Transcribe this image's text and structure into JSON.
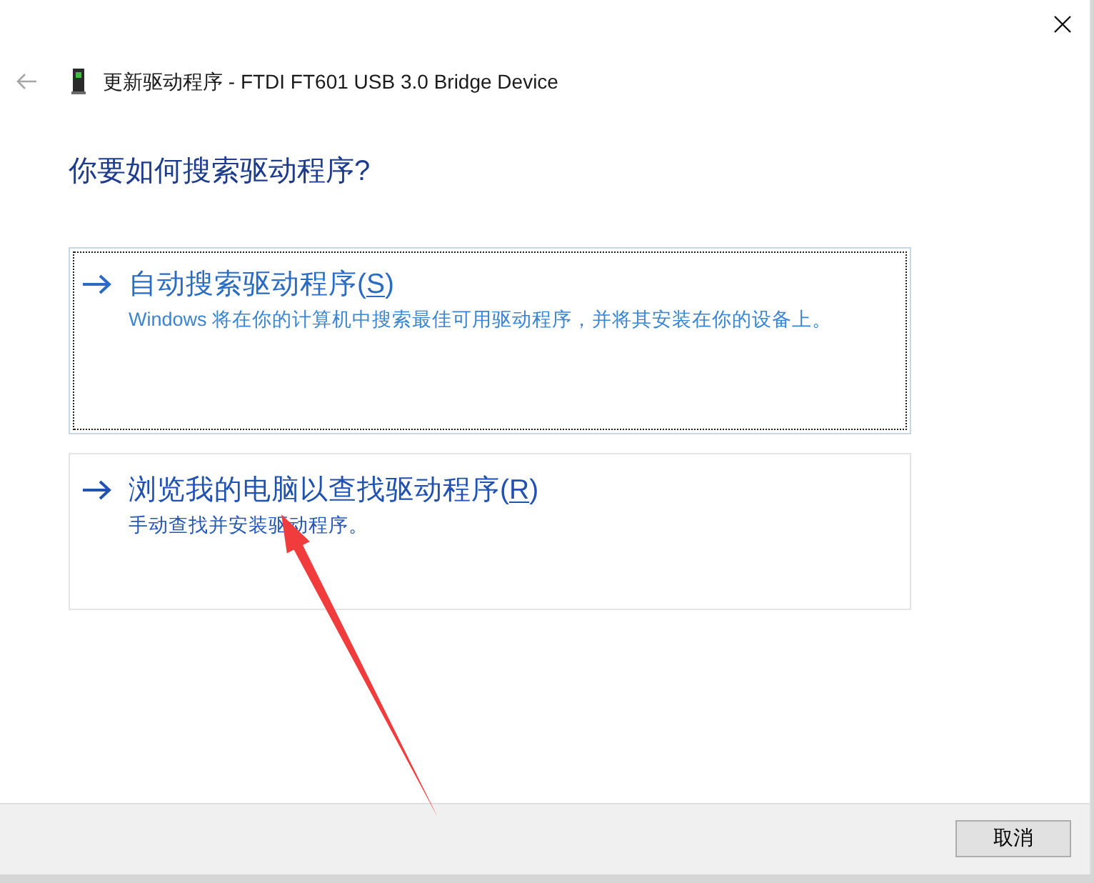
{
  "header": {
    "back_button": {
      "disabled": true
    },
    "title": "更新驱动程序 - FTDI FT601 USB 3.0 Bridge Device"
  },
  "question": "你要如何搜索驱动程序?",
  "options": [
    {
      "title": "自动搜索驱动程序(S)",
      "access_key_underlined": true,
      "description": "Windows 将在你的计算机中搜索最佳可用驱动程序，并将其安装在你的设备上。",
      "focused": true
    },
    {
      "title": "浏览我的电脑以查找驱动程序(R)",
      "access_key_underlined": true,
      "description": "手动查找并安装驱动程序。",
      "focused": false
    }
  ],
  "footer": {
    "buttons": [
      "取消"
    ]
  }
}
